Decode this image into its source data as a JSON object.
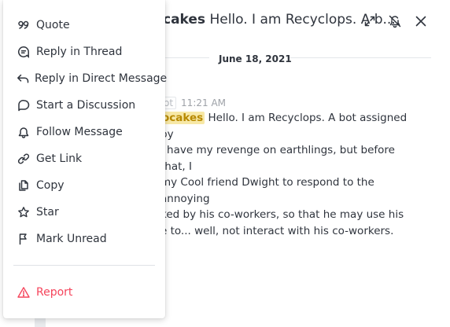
{
  "header": {
    "title_name": "cakes",
    "title_text": " Hello. I am Recyclops. A b...",
    "icons": [
      "expand-icon",
      "bell-off-icon",
      "close-icon"
    ]
  },
  "timeline": {
    "date": "June 18, 2021"
  },
  "message": {
    "role_badge": "ot",
    "time": "11:21 AM",
    "mention": "ocakes",
    "lines": [
      " Hello. I am Recyclops. A bot assigned by",
      "l have my revenge on earthlings, but before that, I",
      "my Cool friend Dwight to respond to the annoying",
      "ked by his co-workers, so that he may use his",
      "e to... well, not interact with his co-workers."
    ]
  },
  "menu": {
    "items": [
      {
        "label": "Quote",
        "icon": "quote-icon"
      },
      {
        "label": "Reply in Thread",
        "icon": "thread-icon"
      },
      {
        "label": "Reply in Direct Message",
        "icon": "reply-arrow-icon"
      },
      {
        "label": "Start a Discussion",
        "icon": "discussion-icon"
      },
      {
        "label": "Follow Message",
        "icon": "bell-icon"
      },
      {
        "label": "Get Link",
        "icon": "link-icon"
      },
      {
        "label": "Copy",
        "icon": "copy-icon"
      },
      {
        "label": "Star",
        "icon": "star-icon"
      },
      {
        "label": "Mark Unread",
        "icon": "flag-icon"
      }
    ],
    "report": {
      "label": "Report",
      "icon": "warning-icon"
    }
  },
  "colors": {
    "danger": "#f5455c",
    "mention_bg": "#f7e8a6",
    "mention_fg": "#b88900",
    "text": "#2f343d",
    "muted": "#9ea2a8"
  }
}
